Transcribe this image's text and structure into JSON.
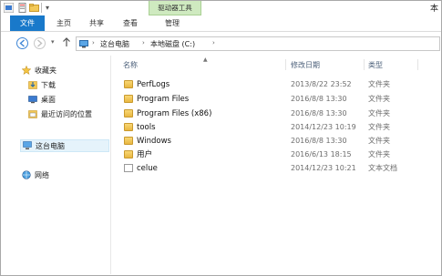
{
  "title_bar": {
    "context_tab": "驱动器工具",
    "title_fragment": "本"
  },
  "ribbon": {
    "tabs": [
      {
        "label": "文件"
      },
      {
        "label": "主页"
      },
      {
        "label": "共享"
      },
      {
        "label": "查看"
      },
      {
        "label": "管理"
      }
    ]
  },
  "address": {
    "crumbs": [
      "这台电脑",
      "本地磁盘 (C:)"
    ]
  },
  "sidebar": {
    "favorites": {
      "label": "收藏夹"
    },
    "favorites_items": [
      {
        "label": "下载",
        "icon": "download-icon"
      },
      {
        "label": "桌面",
        "icon": "desktop-icon"
      },
      {
        "label": "最近访问的位置",
        "icon": "recent-places-icon"
      }
    ],
    "this_pc": {
      "label": "这台电脑"
    },
    "network": {
      "label": "网络"
    }
  },
  "columns": {
    "name": "名称",
    "modified": "修改日期",
    "type": "类型"
  },
  "files": [
    {
      "name": "PerfLogs",
      "date": "2013/8/22 23:52",
      "type": "文件夹",
      "icon": "folder-icon"
    },
    {
      "name": "Program Files",
      "date": "2016/8/8 13:30",
      "type": "文件夹",
      "icon": "folder-icon"
    },
    {
      "name": "Program Files (x86)",
      "date": "2016/8/8 13:30",
      "type": "文件夹",
      "icon": "folder-icon"
    },
    {
      "name": "tools",
      "date": "2014/12/23 10:19",
      "type": "文件夹",
      "icon": "folder-icon"
    },
    {
      "name": "Windows",
      "date": "2016/8/8 13:30",
      "type": "文件夹",
      "icon": "folder-icon"
    },
    {
      "name": "用户",
      "date": "2016/6/13 18:15",
      "type": "文件夹",
      "icon": "folder-icon"
    },
    {
      "name": "celue",
      "date": "2014/12/23 10:21",
      "type": "文本文档",
      "icon": "text-file-icon"
    }
  ],
  "colors": {
    "file_tab": "#1979ca",
    "context_tab_bg": "#cfeac0",
    "selection": "#e5f3fb",
    "folder": "#e9b741"
  }
}
